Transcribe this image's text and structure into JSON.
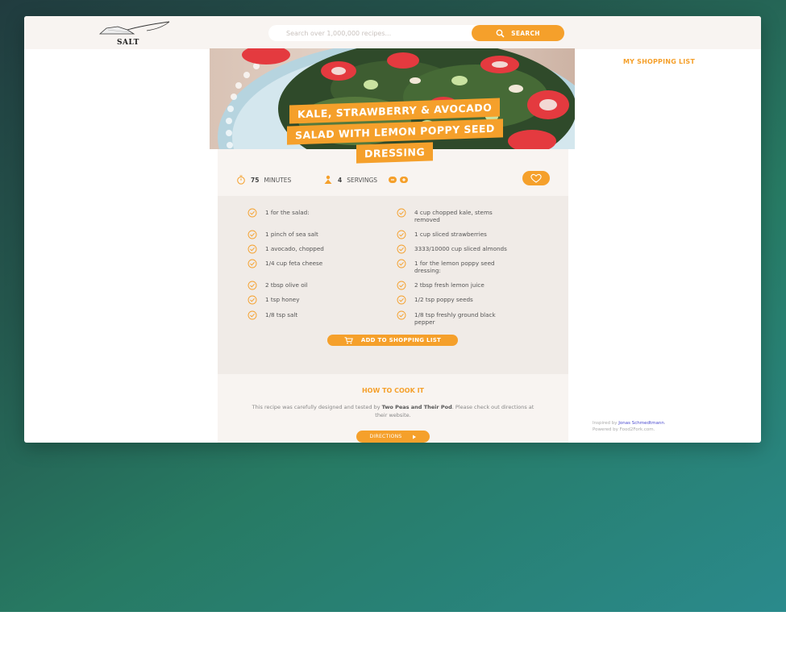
{
  "header": {
    "logo_text": "SALT",
    "search_placeholder": "Search over 1,000,000 recipes...",
    "search_button": "SEARCH"
  },
  "recipe": {
    "title_lines": [
      "KALE, STRAWBERRY & AVOCADO",
      "SALAD WITH LEMON POPPY SEED",
      "DRESSING"
    ],
    "minutes_value": "75",
    "minutes_label": "MINUTES",
    "servings_value": "4",
    "servings_label": "SERVINGS",
    "ingredients": [
      {
        "qty": "1",
        "text": "for the salad:"
      },
      {
        "qty": "4",
        "text": "cup chopped kale, stems removed"
      },
      {
        "qty": "1",
        "text": "pinch of sea salt"
      },
      {
        "qty": "1",
        "text": "cup sliced strawberries"
      },
      {
        "qty": "1",
        "text": "avocado, chopped"
      },
      {
        "qty": "3333/10000",
        "text": "cup sliced almonds"
      },
      {
        "qty": "1/4",
        "text": "cup feta cheese"
      },
      {
        "qty": "1",
        "text": "for the lemon poppy seed dressing:"
      },
      {
        "qty": "2",
        "text": "tbsp olive oil"
      },
      {
        "qty": "2",
        "text": "tbsp fresh lemon juice"
      },
      {
        "qty": "1",
        "text": "tsp honey"
      },
      {
        "qty": "1/2",
        "text": "tsp poppy seeds"
      },
      {
        "qty": "1/8",
        "text": "tsp salt"
      },
      {
        "qty": "1/8",
        "text": "tsp freshly ground black pepper"
      }
    ],
    "add_button": "ADD TO SHOPPING LIST",
    "cook_title": "HOW TO COOK IT",
    "cook_text_pre": "This recipe was carefully designed and tested by ",
    "cook_publisher": "Two Peas and Their Pod",
    "cook_text_post": ". Please check out directions at their website.",
    "directions_button": "DIRECTIONS"
  },
  "sidebar": {
    "shopping_title": "MY SHOPPING LIST",
    "credit_prefix": "Inspired by ",
    "credit_author": "Jonas Schmedtmann",
    "credit_suffix": ".",
    "powered_by": "Powered by Food2Fork.com."
  },
  "colors": {
    "accent": "#f5a02b",
    "panel": "#f8f4f1",
    "ingredients_bg": "#f0ebe7"
  }
}
